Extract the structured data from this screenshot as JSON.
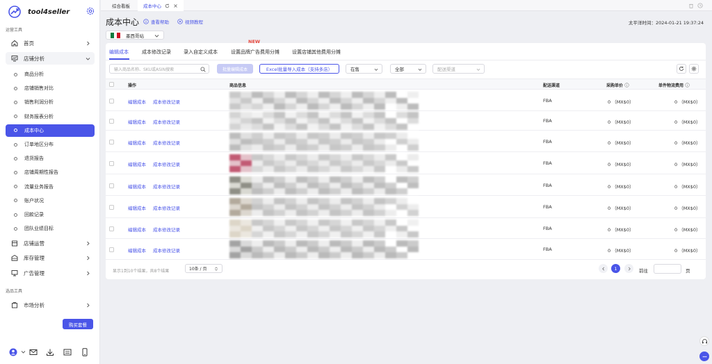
{
  "app": {
    "name": "tool4seller"
  },
  "sidebar": {
    "section_ops": "运营工具",
    "section_select": "选品工具",
    "home": "首页",
    "store_analysis": "店铺分析",
    "sub_items": [
      "商品分析",
      "店铺销售对比",
      "销售利润分析",
      "财务报表分析",
      "成本中心",
      "订单地区分布",
      "退货报告",
      "店铺周期性报告",
      "流量业务报告",
      "账户状况",
      "回款记录",
      "团队业绩目标"
    ],
    "store_ops": "店铺运营",
    "inventory": "库存管理",
    "ads": "广告管理",
    "market": "市场分析",
    "buy_button": "购买套餐"
  },
  "topbar": {
    "tabs": [
      {
        "label": "综合看板"
      },
      {
        "label": "成本中心"
      }
    ]
  },
  "header": {
    "title": "成本中心",
    "help": "查看帮助",
    "video": "视频教程",
    "time": "太平洋时间：2024-01-21 19:37:24",
    "site": "墨西哥站"
  },
  "subtabs": [
    "编辑成本",
    "成本修改记录",
    "录入自定义成本",
    "设置品牌广告费用分摊",
    "设置店铺其他费用分摊"
  ],
  "new_badge": "NEW",
  "filters": {
    "search_placeholder": "输入商品名称、SKU或ASIN搜索",
    "batch_button": "批量编辑成本",
    "excel_button": "Excel批量导入成本（支持多店）",
    "status": "在售",
    "scope": "全部",
    "channel_placeholder": "配送渠道"
  },
  "table": {
    "headers": {
      "op": "操作",
      "info": "商品信息",
      "channel": "配送渠道",
      "unit_price": "采购单价",
      "shipping": "单件物流费用"
    },
    "rows": [
      {
        "edit": "编辑成本",
        "log": "成本修改记录",
        "channel": "FBA",
        "price": "0 （MX$0）",
        "ship": "0 （MX$0）"
      },
      {
        "edit": "编辑成本",
        "log": "成本修改记录",
        "channel": "FBA",
        "price": "0 （MX$0）",
        "ship": "0 （MX$0）"
      },
      {
        "edit": "编辑成本",
        "log": "成本修改记录",
        "channel": "FBA",
        "price": "0 （MX$0）",
        "ship": "0 （MX$0）"
      },
      {
        "edit": "编辑成本",
        "log": "成本修改记录",
        "channel": "FBA",
        "price": "0 （MX$0）",
        "ship": "0 （MX$0）"
      },
      {
        "edit": "编辑成本",
        "log": "成本修改记录",
        "channel": "FBA",
        "price": "0 （MX$0）",
        "ship": "0 （MX$0）"
      },
      {
        "edit": "编辑成本",
        "log": "成本修改记录",
        "channel": "FBA",
        "price": "0 （MX$0）",
        "ship": "0 （MX$0）"
      },
      {
        "edit": "编辑成本",
        "log": "成本修改记录",
        "channel": "FBA",
        "price": "0 （MX$0）",
        "ship": "0 （MX$0）"
      },
      {
        "edit": "编辑成本",
        "log": "成本修改记录",
        "channel": "FBA",
        "price": "0 （MX$0）",
        "ship": "0 （MX$0）"
      }
    ]
  },
  "pagination": {
    "range_text": "显示1到10个结果，共8个结果",
    "page_size": "10条 / 页",
    "current_page": "1",
    "goto_label": "前往",
    "page_unit": "页"
  },
  "colors": {
    "accent": "#4a55e8",
    "new_badge": "#e8473c"
  }
}
